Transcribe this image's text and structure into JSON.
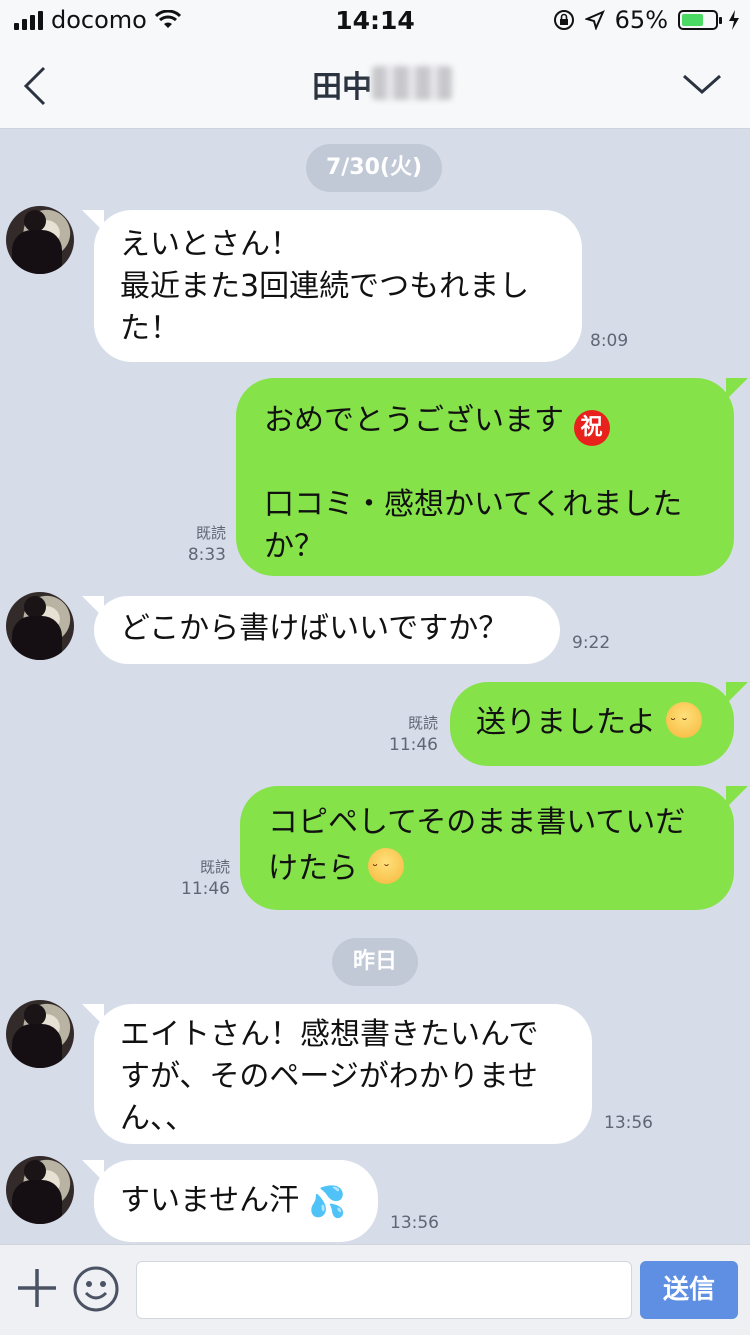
{
  "status_bar": {
    "carrier": "docomo",
    "time": "14:14",
    "battery_percent": "65%",
    "battery_level": 0.65
  },
  "header": {
    "title": "田中",
    "back_icon": "chevron-left-icon",
    "menu_icon": "chevron-down-icon"
  },
  "date_pills": {
    "first": "7/30(火)",
    "second": "昨日"
  },
  "messages": [
    {
      "side": "in",
      "text": "えいとさん！\n最近また3回連続でつもれまし\nた！",
      "time": "8:09"
    },
    {
      "side": "out",
      "text_line1": "おめでとうございます",
      "text_rest": "口コミ・感想かいてくれました\nか？",
      "read": "既読",
      "time": "8:33"
    },
    {
      "side": "in",
      "text": "どこから書けばいいですか？",
      "time": "9:22"
    },
    {
      "side": "out",
      "text": "送りましたよ",
      "read": "既読",
      "time": "11:46"
    },
    {
      "side": "out",
      "text_line1": "コピペしてそのまま書いていだ",
      "text_line2": "けたら",
      "read": "既読",
      "time": "11:46"
    },
    {
      "side": "in",
      "text": "エイトさん！感想書きたいんで\nすが、そのページがわかりませ\nん、、",
      "time": "13:56"
    },
    {
      "side": "in",
      "text": "すいません汗",
      "time": "13:56"
    }
  ],
  "input_bar": {
    "placeholder": "",
    "send_label": "送信"
  },
  "colors": {
    "background": "#d6dde9",
    "outgoing_bubble": "#85e249",
    "incoming_bubble": "#ffffff",
    "send_button": "#5f8fe3"
  }
}
